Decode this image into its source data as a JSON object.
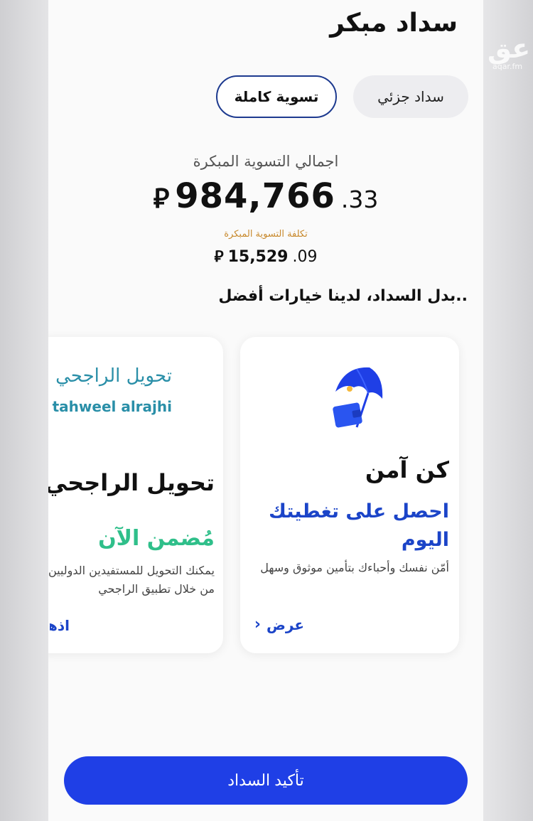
{
  "watermark": {
    "glyph": "عق",
    "site": "aqar.fm"
  },
  "header": {
    "title": "سداد مبكر"
  },
  "segments": {
    "full": "تسوية كاملة",
    "partial": "سداد جزئي",
    "selected": "full"
  },
  "settlement": {
    "total_label": "اجمالي التسوية المبكرة",
    "amount_int": "984,766",
    "amount_dec": ".33",
    "currency_symbol": "⃁",
    "cost_label": "تكلفة التسوية المبكرة",
    "cost_int": "15,529",
    "cost_dec": ".09"
  },
  "options_heading": "..بدل السداد، لدينا خيارات أفضل",
  "cards": {
    "insurance": {
      "icon": "umbrella-wallet-icon",
      "title": "كن آمن",
      "subtitle": "احصل على تغطيتك اليوم",
      "description": "أمّن نفسك وأحباءك بتأمين موثوق وسهل",
      "link": "عرض",
      "link_icon": "chevron-left-icon"
    },
    "tahweel": {
      "logo_ar": "تحويل الراجحي",
      "logo_en": "tahweel alrajhi",
      "title": "تحويل الراجحي",
      "highlight": "مُضمن الآن",
      "description_line1": "يمكنك التحويل للمستفيدين الدوليين",
      "description_line2": "من خلال تطبيق الراجحي",
      "link": "اذهب"
    }
  },
  "footer": {
    "confirm_label": "تأكيد السداد"
  },
  "colors": {
    "primary": "#1f3fe6",
    "link_blue": "#1b44c8",
    "accent_gold": "#c8892c",
    "accent_green": "#2fbf8a",
    "logo_teal": "#2a8fa8"
  }
}
